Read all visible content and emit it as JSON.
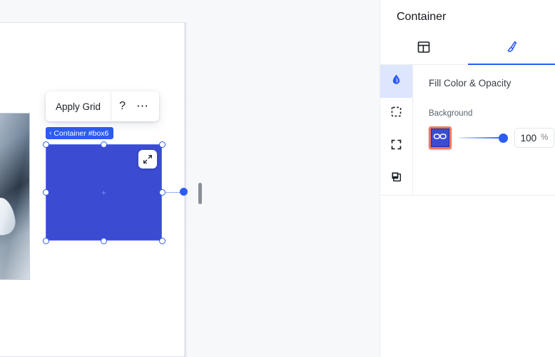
{
  "canvas": {
    "toolbar": {
      "apply_grid_label": "Apply Grid",
      "help_label": "?",
      "more_label": "⋯"
    },
    "selection": {
      "badge_chevron": "‹",
      "badge_label": "Container #box6"
    },
    "photo_element_name": "image-element"
  },
  "panel": {
    "title": "Container",
    "tabs": [
      {
        "name": "layout",
        "icon": "layout-grid-icon",
        "active": false
      },
      {
        "name": "style",
        "icon": "paint-brush-icon",
        "active": true
      }
    ],
    "rail": [
      {
        "name": "fill",
        "icon": "droplet-icon",
        "active": true
      },
      {
        "name": "selection",
        "icon": "dashed-square-icon",
        "active": false
      },
      {
        "name": "bounds",
        "icon": "corner-brackets-icon",
        "active": false
      },
      {
        "name": "layers",
        "icon": "layers-stack-icon",
        "active": false
      }
    ],
    "section_title": "Fill Color & Opacity",
    "background_label": "Background",
    "opacity_value": "100",
    "opacity_unit": "%",
    "swatch_icon": "chain-link-icon"
  },
  "colors": {
    "accent_blue": "#2c5cf0",
    "box_fill": "#3b4bd2",
    "swatch_highlight": "#f4775a",
    "canvas_bg": "#f7f8f9",
    "rail_active_bg": "#dee6fd"
  }
}
